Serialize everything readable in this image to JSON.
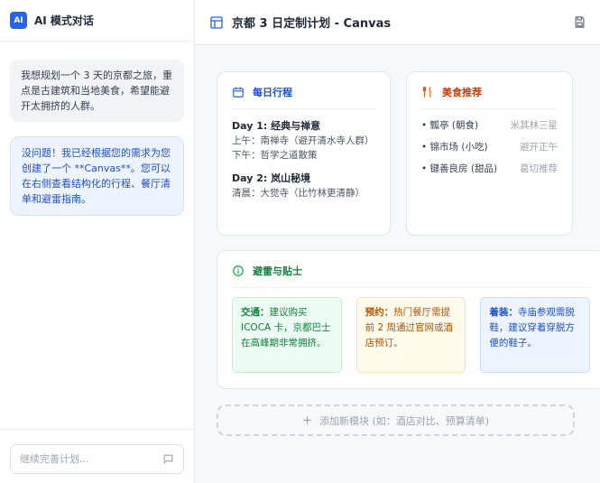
{
  "sidebar": {
    "logo_text": "AI",
    "title": "AI 模式对话",
    "messages": [
      {
        "role": "user",
        "text": "我想规划一个 3 天的京都之旅，重点是古建筑和当地美食，希望能避开太拥挤的人群。"
      },
      {
        "role": "ai",
        "text": "没问题！我已经根据您的需求为您创建了一个 **Canvas**。您可以在右侧查看结构化的行程、餐厅清单和避雷指南。"
      }
    ],
    "input_placeholder": "继续完善计划..."
  },
  "header": {
    "title": "京都 3 日定制计划 - Canvas",
    "icons": [
      "layout-icon",
      "save-icon",
      "share-icon"
    ]
  },
  "itinerary": {
    "title": "每日行程",
    "days": [
      {
        "title": "Day 1: 经典与禅意",
        "lines": [
          "上午：南禅寺（避开清水寺人群）",
          "下午：哲学之道散策"
        ]
      },
      {
        "title": "Day 2: 岚山秘境",
        "lines": [
          "清晨：大觉寺（比竹林更清静）"
        ]
      }
    ]
  },
  "food": {
    "title": "美食推荐",
    "items": [
      {
        "name": "• 瓢亭 (朝食)",
        "tag": "米其林三星"
      },
      {
        "name": "• 锦市场 (小吃)",
        "tag": "避开正午"
      },
      {
        "name": "• 键善良房 (甜品)",
        "tag": "葛切推荐"
      }
    ]
  },
  "tips": {
    "title": "避雷与贴士",
    "items": [
      {
        "label": "交通：",
        "text": "建议购买 ICOCA 卡，京都巴士在高峰期非常拥挤。",
        "color": "#15803d"
      },
      {
        "label": "预约：",
        "text": "热门餐厅需提前 2 周通过官网或酒店预订。",
        "color": "#b45309"
      },
      {
        "label": "着装：",
        "text": "寺庙参观需脱鞋，建议穿着穿脱方便的鞋子。",
        "color": "#1d4ed8"
      }
    ]
  },
  "add_module": {
    "label": "添加新模块 (如：酒店对比、预算清单)"
  },
  "colors": {
    "accent": "#2563eb",
    "orange": "#ea580c",
    "green": "#16a34a"
  }
}
